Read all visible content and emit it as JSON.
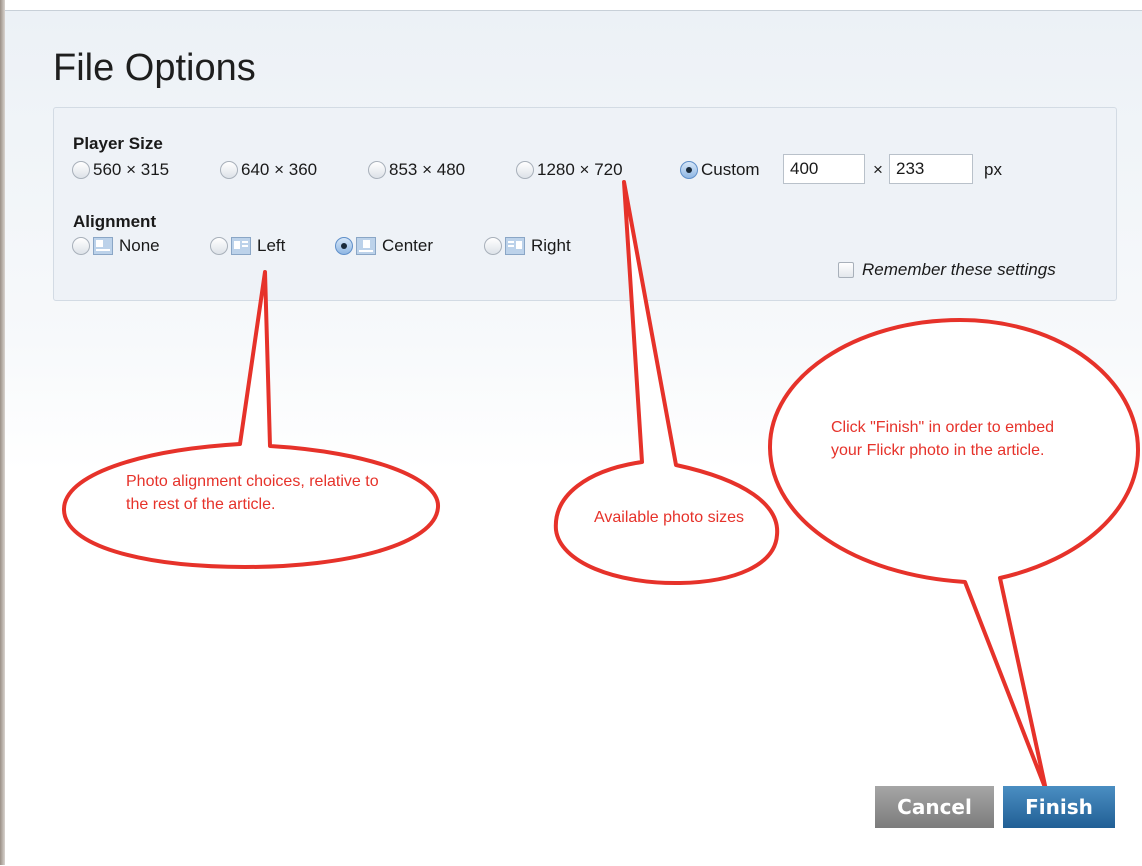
{
  "dialog": {
    "title": "File Options"
  },
  "player_size": {
    "label": "Player Size",
    "options": [
      {
        "label": "560 × 315",
        "selected": false
      },
      {
        "label": "640 × 360",
        "selected": false
      },
      {
        "label": "853 × 480",
        "selected": false
      },
      {
        "label": "1280 × 720",
        "selected": false
      },
      {
        "label": "Custom",
        "selected": true
      }
    ],
    "custom_width": "400",
    "times_sign": "×",
    "custom_height": "233",
    "unit": "px"
  },
  "alignment": {
    "label": "Alignment",
    "options": [
      {
        "label": "None",
        "selected": false,
        "icon": "align-none-icon"
      },
      {
        "label": "Left",
        "selected": false,
        "icon": "align-left-icon"
      },
      {
        "label": "Center",
        "selected": true,
        "icon": "align-center-icon"
      },
      {
        "label": "Right",
        "selected": false,
        "icon": "align-right-icon"
      }
    ]
  },
  "remember": {
    "label": "Remember these settings",
    "checked": false
  },
  "buttons": {
    "cancel": "Cancel",
    "finish": "Finish"
  },
  "annotations": {
    "alignment_note": "Photo alignment choices, relative to the rest of the article.",
    "sizes_note": "Available photo sizes",
    "finish_note": "Click \"Finish\" in order to embed your Flickr photo in the article.",
    "color": "#e6322a"
  }
}
